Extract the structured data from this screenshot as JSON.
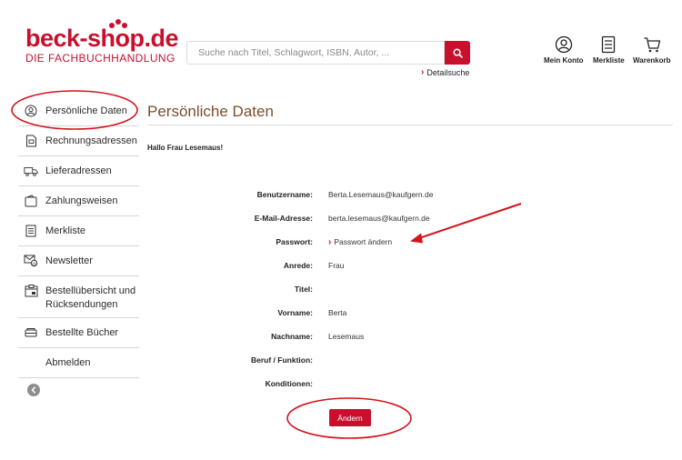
{
  "header": {
    "logo_main": "beck-shop.de",
    "logo_sub": "DIE FACHBUCHHANDLUNG",
    "search_placeholder": "Suche nach Titel, Schlagwort, ISBN, Autor, ...",
    "detail_search": "Detailsuche",
    "icons": {
      "account_label": "Mein Konto",
      "wishlist_label": "Merkliste",
      "cart_label": "Warenkorb"
    }
  },
  "sidebar": {
    "items": [
      {
        "label": "Persönliche Daten",
        "icon": "user-icon"
      },
      {
        "label": "Rechnungsadressen",
        "icon": "invoice-icon"
      },
      {
        "label": "Lieferadressen",
        "icon": "truck-icon"
      },
      {
        "label": "Zahlungsweisen",
        "icon": "wallet-icon"
      },
      {
        "label": "Merkliste",
        "icon": "list-icon"
      },
      {
        "label": "Newsletter",
        "icon": "newsletter-icon"
      },
      {
        "label": "Bestellübersicht und Rücksendungen",
        "icon": "orders-icon"
      },
      {
        "label": "Bestellte Bücher",
        "icon": "books-icon"
      },
      {
        "label": "Abmelden",
        "icon": ""
      }
    ]
  },
  "main": {
    "title": "Persönliche Daten",
    "greeting": "Hallo Frau Lesemaus!",
    "fields": [
      {
        "label": "Benutzername:",
        "value": "Berta.Lesemaus@kaufgern.de"
      },
      {
        "label": "E-Mail-Adresse:",
        "value": "berta.lesemaus@kaufgern.de"
      },
      {
        "label": "Passwort:",
        "value": "Passwort ändern"
      },
      {
        "label": "Anrede:",
        "value": "Frau"
      },
      {
        "label": "Titel:",
        "value": ""
      },
      {
        "label": "Vorname:",
        "value": "Berta"
      },
      {
        "label": "Nachname:",
        "value": "Lesemaus"
      },
      {
        "label": "Beruf / Funktion:",
        "value": ""
      },
      {
        "label": "Konditionen:",
        "value": ""
      }
    ],
    "change_button": "Ändern"
  },
  "colors": {
    "brand_red": "#c8102e",
    "title_brown": "#7a4f2a",
    "annotation_red": "#d3141c"
  }
}
